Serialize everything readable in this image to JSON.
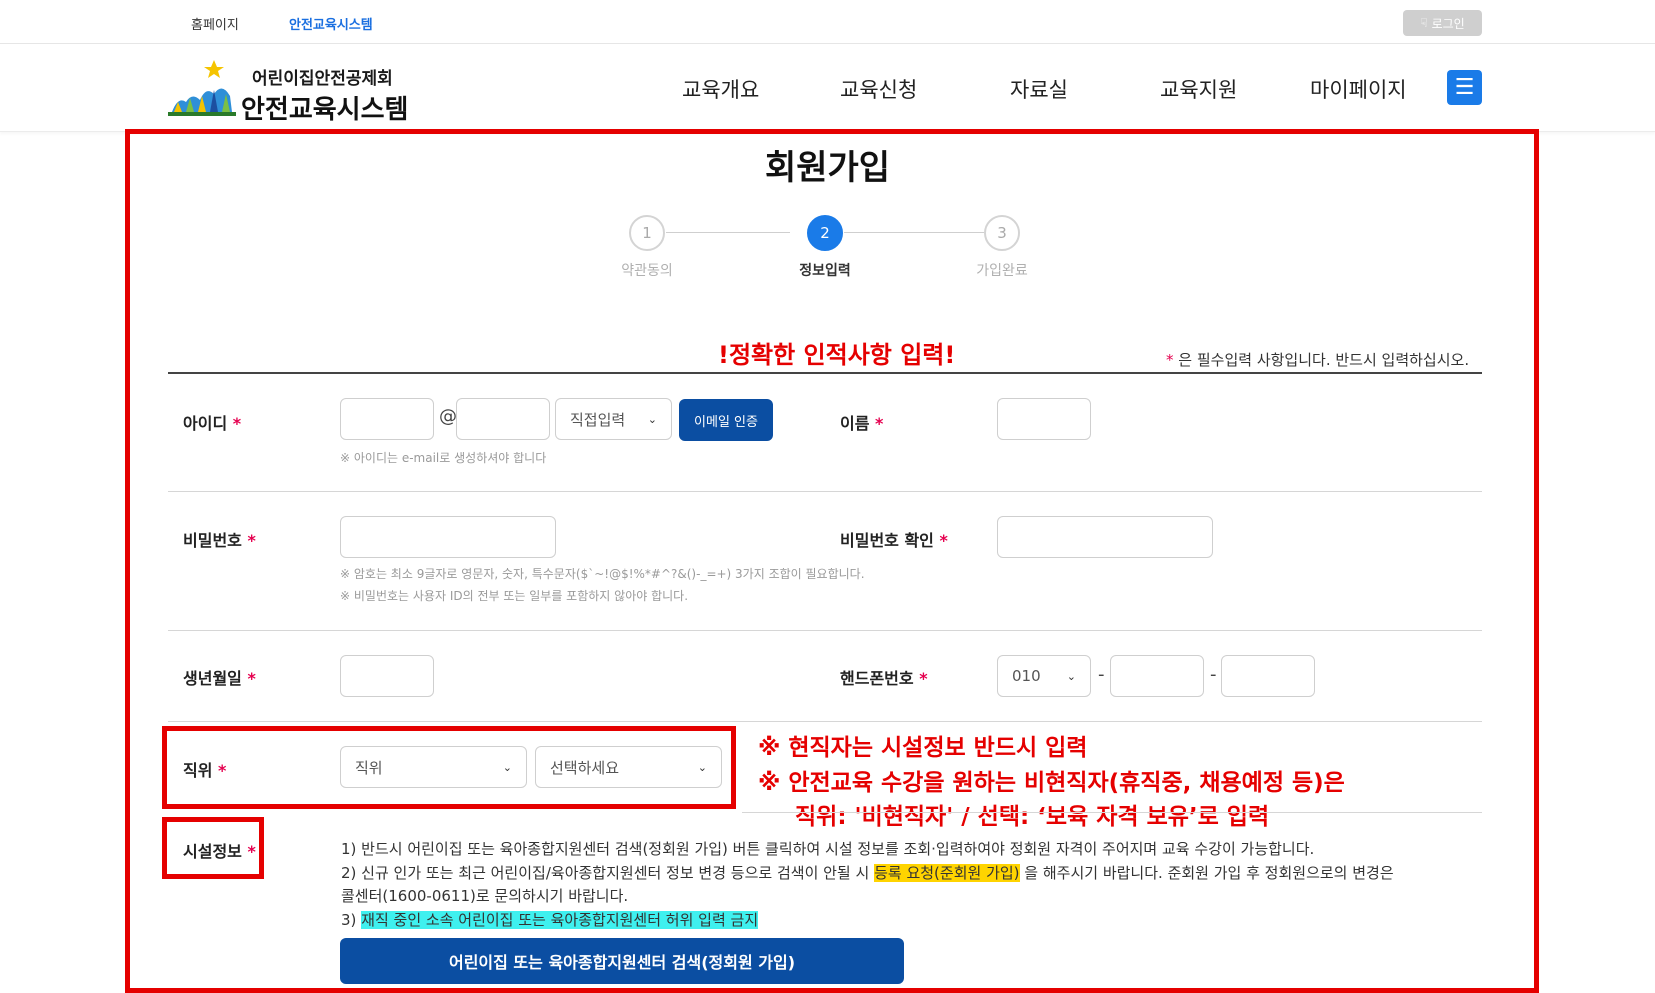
{
  "topbar": {
    "home_link": "홈페이지",
    "system_link": "안전교육시스템",
    "login_button": "로그인"
  },
  "header": {
    "logo_subtitle": "어린이집안전공제회",
    "logo_title": "안전교육시스템",
    "nav": [
      "교육개요",
      "교육신청",
      "자료실",
      "교육지원",
      "마이페이지"
    ],
    "menu_icon": "hamburger-icon"
  },
  "page": {
    "title": "회원가입",
    "steps": [
      {
        "number": "1",
        "label": "약관동의",
        "active": false
      },
      {
        "number": "2",
        "label": "정보입력",
        "active": true
      },
      {
        "number": "3",
        "label": "가입완료",
        "active": false
      }
    ],
    "warning_title": "!정확한 인적사항 입력!",
    "required_note_star": "*",
    "required_note": "은 필수입력 사항입니다. 반드시 입력하십시오."
  },
  "form": {
    "required_mark": "*",
    "id": {
      "label": "아이디",
      "at_sign": "@",
      "domain_select": "직접입력",
      "email_verify_button": "이메일 인증",
      "help": "※ 아이디는 e-mail로 생성하셔야 합니다"
    },
    "name": {
      "label": "이름"
    },
    "password": {
      "label": "비밀번호",
      "help1": "※ 암호는 최소 9글자로 영문자, 숫자, 특수문자($`~!@$!%*#^?&()-_=+) 3가지 조합이 필요합니다.",
      "help2": "※ 비밀번호는 사용자 ID의 전부 또는 일부를 포함하지 않아야 합니다."
    },
    "password_confirm": {
      "label": "비밀번호 확인"
    },
    "birth": {
      "label": "생년월일"
    },
    "phone": {
      "label": "핸드폰번호",
      "prefix": "010",
      "dash": "-"
    },
    "position": {
      "label": "직위",
      "select1": "직위",
      "select2": "선택하세요"
    },
    "facility": {
      "label": "시설정보",
      "line1": "1) 반드시 어린이집 또는 육아종합지원센터 검색(정회원 가입) 버튼 클릭하여 시설 정보를 조회·입력하여야 정회원 자격이 주어지며 교육 수강이 가능합니다.",
      "line2_a": "2) 신규 인가 또는 최근 어린이집/육아종합지원센터 정보 변경 등으로 검색이 안될 시 ",
      "line2_hl": "등록 요청(준회원 가입)",
      "line2_b": " 을 해주시기 바랍니다. 준회원 가입 후 정회원으로의 변경은",
      "line2_c": "콜센터(1600-0611)로 문의하시기 바랍니다.",
      "line3_a": "3) ",
      "line3_hl": "재직 중인 소속 어린이집 또는 육아종합지원센터 허위 입력 금지",
      "search_button": "어린이집 또는 육아종합지원센터 검색(정회원 가입)"
    }
  },
  "annotations": {
    "line1": "※ 현직자는 시설정보 반드시 입력",
    "line2": "※ 안전교육 수강을 원하는 비현직자(휴직중, 채용예정 등)은",
    "line3": "직위: '비현직자' / 선택: ‘보육 자격 보유’로 입력"
  },
  "colors": {
    "accent_blue": "#1a7be8",
    "button_navy": "#0b4ea2",
    "annotation_red": "#e50000",
    "required_star": "#e5004f",
    "highlight_yellow": "#ffd400",
    "highlight_cyan": "#3ff0ef"
  }
}
